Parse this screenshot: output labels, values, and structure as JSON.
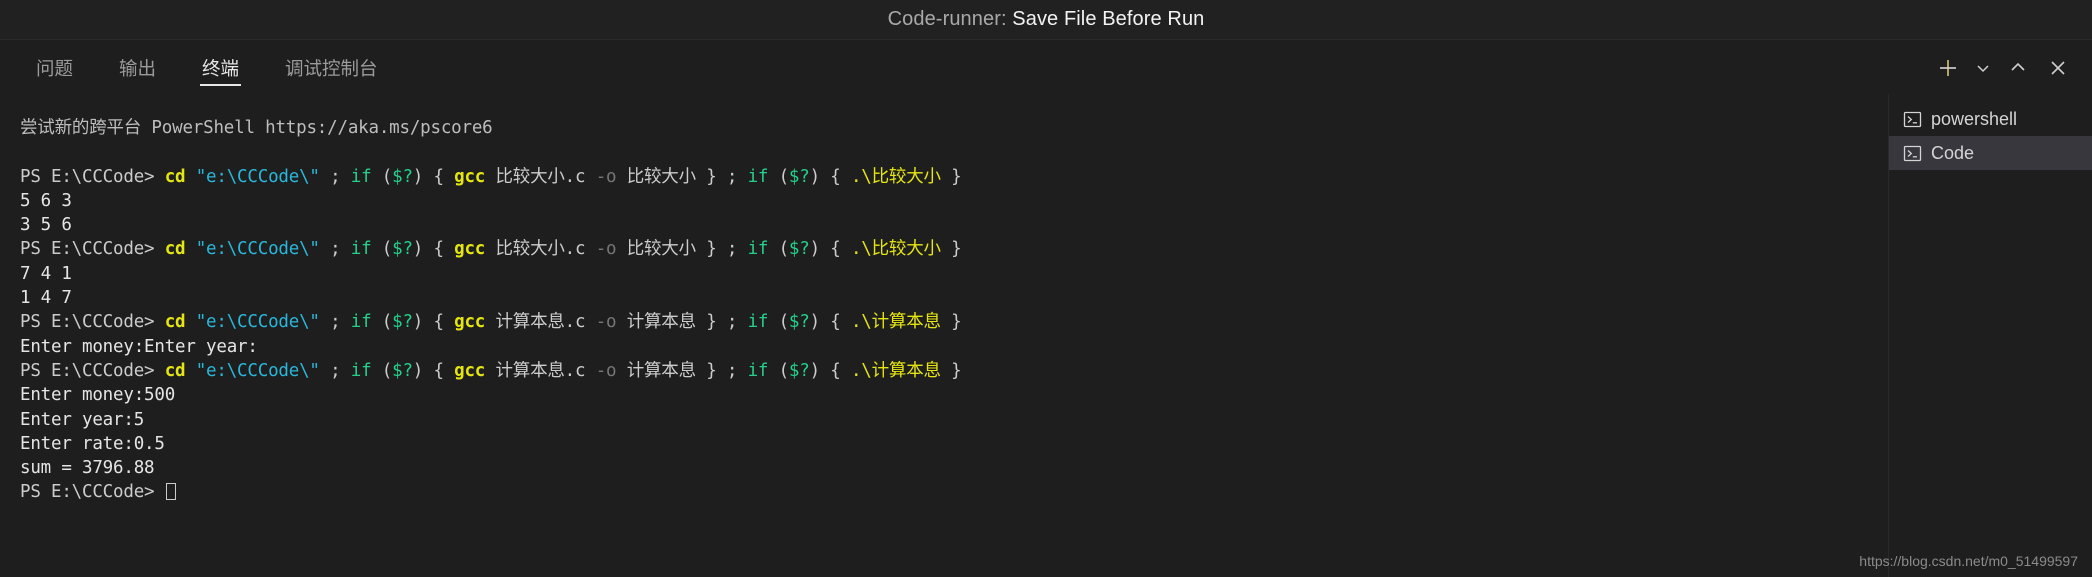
{
  "titlebar": {
    "prefix": "Code-runner: ",
    "main": "Save File Before Run"
  },
  "panel": {
    "tabs": [
      {
        "label": "问题",
        "active": false
      },
      {
        "label": "输出",
        "active": false
      },
      {
        "label": "终端",
        "active": true
      },
      {
        "label": "调试控制台",
        "active": false
      }
    ],
    "actions": [
      {
        "name": "new-terminal-button",
        "icon": "plus-icon"
      },
      {
        "name": "terminal-dropdown-button",
        "icon": "chevron-down-icon"
      },
      {
        "name": "maximize-panel-button",
        "icon": "chevron-up-icon"
      },
      {
        "name": "close-panel-button",
        "icon": "close-icon"
      }
    ]
  },
  "terminal_list": {
    "items": [
      {
        "label": "powershell",
        "icon": "terminal-icon",
        "selected": false
      },
      {
        "label": "Code",
        "icon": "terminal-icon",
        "selected": true
      }
    ]
  },
  "terminal": {
    "lines": [
      {
        "id": "banner",
        "segments": [
          {
            "text": "尝试新的跨平台 PowerShell https://aka.ms/pscore6",
            "color": "grey"
          }
        ]
      },
      {
        "id": "blank-1",
        "segments": []
      },
      {
        "id": "cmd-1",
        "segments": [
          {
            "text": "PS E:\\CCCode> ",
            "color": "default"
          },
          {
            "text": "cd",
            "color": "yellow"
          },
          {
            "text": " ",
            "color": "default"
          },
          {
            "text": "\"e:\\CCCode\\\"",
            "color": "cyan"
          },
          {
            "text": " ; ",
            "color": "default"
          },
          {
            "text": "if",
            "color": "green"
          },
          {
            "text": " (",
            "color": "default"
          },
          {
            "text": "$?",
            "color": "green"
          },
          {
            "text": ") { ",
            "color": "default"
          },
          {
            "text": "gcc",
            "color": "yellow"
          },
          {
            "text": " 比较大小.c ",
            "color": "default"
          },
          {
            "text": "-o",
            "color": "dim"
          },
          {
            "text": " 比较大小 } ; ",
            "color": "default"
          },
          {
            "text": "if",
            "color": "green"
          },
          {
            "text": " (",
            "color": "default"
          },
          {
            "text": "$?",
            "color": "green"
          },
          {
            "text": ") { ",
            "color": "default"
          },
          {
            "text": ".\\比较大小",
            "color": "yellow-n"
          },
          {
            "text": " }",
            "color": "default"
          }
        ]
      },
      {
        "id": "out-1",
        "segments": [
          {
            "text": "5 6 3",
            "color": "white"
          }
        ]
      },
      {
        "id": "out-2",
        "segments": [
          {
            "text": "3 5 6",
            "color": "white"
          }
        ]
      },
      {
        "id": "cmd-2",
        "segments": [
          {
            "text": "PS E:\\CCCode> ",
            "color": "default"
          },
          {
            "text": "cd",
            "color": "yellow"
          },
          {
            "text": " ",
            "color": "default"
          },
          {
            "text": "\"e:\\CCCode\\\"",
            "color": "cyan"
          },
          {
            "text": " ; ",
            "color": "default"
          },
          {
            "text": "if",
            "color": "green"
          },
          {
            "text": " (",
            "color": "default"
          },
          {
            "text": "$?",
            "color": "green"
          },
          {
            "text": ") { ",
            "color": "default"
          },
          {
            "text": "gcc",
            "color": "yellow"
          },
          {
            "text": " 比较大小.c ",
            "color": "default"
          },
          {
            "text": "-o",
            "color": "dim"
          },
          {
            "text": " 比较大小 } ; ",
            "color": "default"
          },
          {
            "text": "if",
            "color": "green"
          },
          {
            "text": " (",
            "color": "default"
          },
          {
            "text": "$?",
            "color": "green"
          },
          {
            "text": ") { ",
            "color": "default"
          },
          {
            "text": ".\\比较大小",
            "color": "yellow-n"
          },
          {
            "text": " }",
            "color": "default"
          }
        ]
      },
      {
        "id": "out-3",
        "segments": [
          {
            "text": "7 4 1",
            "color": "white"
          }
        ]
      },
      {
        "id": "out-4",
        "segments": [
          {
            "text": "1 4 7",
            "color": "white"
          }
        ]
      },
      {
        "id": "cmd-3",
        "segments": [
          {
            "text": "PS E:\\CCCode> ",
            "color": "default"
          },
          {
            "text": "cd",
            "color": "yellow"
          },
          {
            "text": " ",
            "color": "default"
          },
          {
            "text": "\"e:\\CCCode\\\"",
            "color": "cyan"
          },
          {
            "text": " ; ",
            "color": "default"
          },
          {
            "text": "if",
            "color": "green"
          },
          {
            "text": " (",
            "color": "default"
          },
          {
            "text": "$?",
            "color": "green"
          },
          {
            "text": ") { ",
            "color": "default"
          },
          {
            "text": "gcc",
            "color": "yellow"
          },
          {
            "text": " 计算本息.c ",
            "color": "default"
          },
          {
            "text": "-o",
            "color": "dim"
          },
          {
            "text": " 计算本息 } ; ",
            "color": "default"
          },
          {
            "text": "if",
            "color": "green"
          },
          {
            "text": " (",
            "color": "default"
          },
          {
            "text": "$?",
            "color": "green"
          },
          {
            "text": ") { ",
            "color": "default"
          },
          {
            "text": ".\\计算本息",
            "color": "yellow-n"
          },
          {
            "text": " }",
            "color": "default"
          }
        ]
      },
      {
        "id": "out-5",
        "segments": [
          {
            "text": "Enter money:Enter year:",
            "color": "white"
          }
        ]
      },
      {
        "id": "cmd-4",
        "segments": [
          {
            "text": "PS E:\\CCCode> ",
            "color": "default"
          },
          {
            "text": "cd",
            "color": "yellow"
          },
          {
            "text": " ",
            "color": "default"
          },
          {
            "text": "\"e:\\CCCode\\\"",
            "color": "cyan"
          },
          {
            "text": " ; ",
            "color": "default"
          },
          {
            "text": "if",
            "color": "green"
          },
          {
            "text": " (",
            "color": "default"
          },
          {
            "text": "$?",
            "color": "green"
          },
          {
            "text": ") { ",
            "color": "default"
          },
          {
            "text": "gcc",
            "color": "yellow"
          },
          {
            "text": " 计算本息.c ",
            "color": "default"
          },
          {
            "text": "-o",
            "color": "dim"
          },
          {
            "text": " 计算本息 } ; ",
            "color": "default"
          },
          {
            "text": "if",
            "color": "green"
          },
          {
            "text": " (",
            "color": "default"
          },
          {
            "text": "$?",
            "color": "green"
          },
          {
            "text": ") { ",
            "color": "default"
          },
          {
            "text": ".\\计算本息",
            "color": "yellow-n"
          },
          {
            "text": " }",
            "color": "default"
          }
        ]
      },
      {
        "id": "out-6",
        "segments": [
          {
            "text": "Enter money:500",
            "color": "white"
          }
        ]
      },
      {
        "id": "out-7",
        "segments": [
          {
            "text": "Enter year:5",
            "color": "white"
          }
        ]
      },
      {
        "id": "out-8",
        "segments": [
          {
            "text": "Enter rate:0.5",
            "color": "white"
          }
        ]
      },
      {
        "id": "out-9",
        "segments": [
          {
            "text": "sum = 3796.88",
            "color": "white"
          }
        ]
      },
      {
        "id": "prompt-last",
        "cursor": true,
        "segments": [
          {
            "text": "PS E:\\CCCode> ",
            "color": "default"
          }
        ]
      }
    ]
  },
  "watermark": {
    "text": "https://blog.csdn.net/m0_51499597"
  }
}
